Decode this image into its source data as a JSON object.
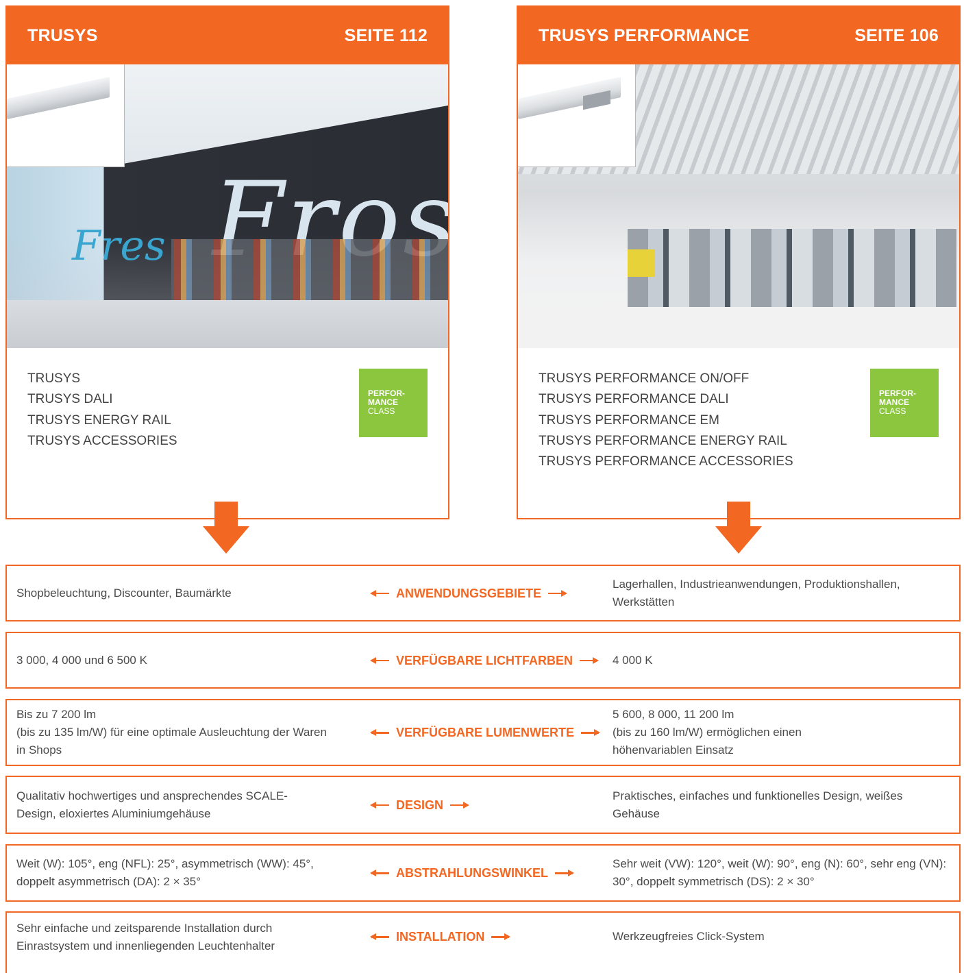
{
  "colors": {
    "accent": "#f26722",
    "badge_green": "#8cc63f"
  },
  "products": [
    {
      "name": "TRUSYS",
      "page": "SEITE 112",
      "variants": [
        "TRUSYS",
        "TRUSYS DALI",
        "TRUSYS ENERGY RAIL",
        "TRUSYS ACCESSORIES"
      ],
      "badge": {
        "line1": "PERFOR-",
        "line2": "MANCE",
        "line3": "CLASS"
      },
      "photo_text": {
        "main": "Frost",
        "side": "Fres"
      }
    },
    {
      "name": "TRUSYS PERFORMANCE",
      "page": "SEITE 106",
      "variants": [
        "TRUSYS PERFORMANCE ON/OFF",
        "TRUSYS PERFORMANCE DALI",
        "TRUSYS PERFORMANCE EM",
        "TRUSYS PERFORMANCE ENERGY RAIL",
        "TRUSYS PERFORMANCE ACCESSORIES"
      ],
      "badge": {
        "line1": "PERFOR-",
        "line2": "MANCE",
        "line3": "CLASS"
      }
    }
  ],
  "comparison": [
    {
      "label": "ANWENDUNGSGEBIETE",
      "left": "Shopbeleuchtung, Discounter, Baumärkte",
      "right": "Lagerhallen, Industrieanwendungen, Produktionshallen, Werkstätten"
    },
    {
      "label": "VERFÜGBARE LICHTFARBEN",
      "left": "3 000, 4 000 und 6 500 K",
      "right": "4 000 K"
    },
    {
      "label": "VERFÜGBARE LUMENWERTE",
      "left": "Bis zu 7 200 lm\n(bis zu 135 lm/W) für eine optimale Ausleuchtung der Waren in Shops",
      "right": "5 600, 8 000, 11 200 lm\n(bis zu 160 lm/W) ermöglichen einen höhenvariablen Einsatz"
    },
    {
      "label": "DESIGN",
      "left": "Qualitativ hochwertiges und ansprechendes SCALE-Design, eloxiertes Aluminiumgehäuse",
      "right": "Praktisches, einfaches und funktionelles Design, weißes Gehäuse"
    },
    {
      "label": "ABSTRAHLUNGSWINKEL",
      "left": "Weit (W): 105°, eng (NFL): 25°, asymmetrisch (WW): 45°, doppelt asymmetrisch (DA): 2 × 35°",
      "right": "Sehr weit (VW): 120°, weit (W): 90°, eng (N): 60°, sehr eng (VN): 30°, doppelt symmetrisch (DS): 2 × 30°"
    },
    {
      "label": "INSTALLATION",
      "left": "Sehr einfache und zeitsparende Installation durch Einrastsystem und innenliegenden Leuchtenhalter",
      "right": "Werkzeugfreies Click-System"
    }
  ]
}
